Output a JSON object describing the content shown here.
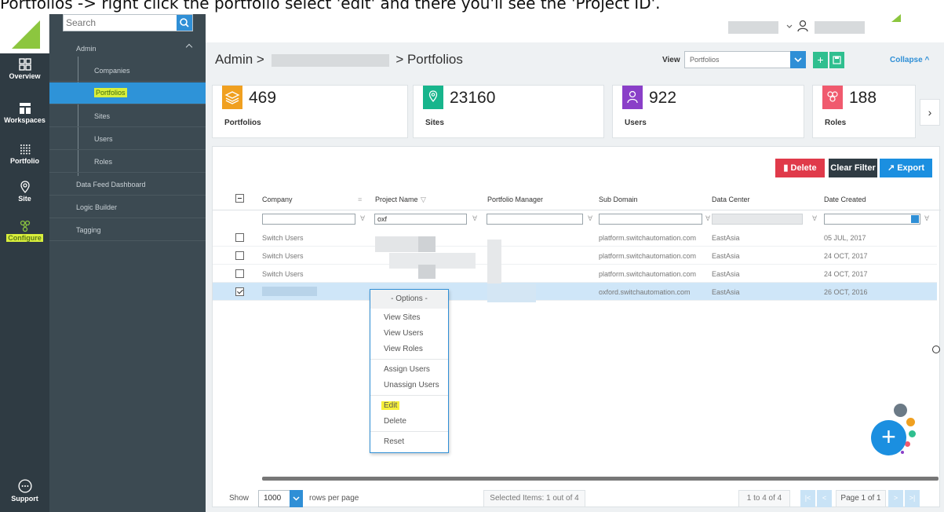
{
  "caption": "Portfolios -> right click the portfolio select 'edit' and there you'll see the 'Project ID'.",
  "colors": {
    "accent": "#2f8fd6",
    "highlight": "#f6f03a",
    "brand_green": "#8cc63f",
    "delete_red": "#e03a4a"
  },
  "rail": {
    "items": [
      {
        "label": "Overview",
        "icon": "grid-icon"
      },
      {
        "label": "Workspaces",
        "icon": "workspace-icon"
      },
      {
        "label": "Portfolio",
        "icon": "dots-grid-icon"
      },
      {
        "label": "Site",
        "icon": "location-pin-icon"
      },
      {
        "label": "Configure",
        "icon": "configure-icon"
      },
      {
        "label": "Support",
        "icon": "chat-bubble-icon"
      }
    ]
  },
  "nav": {
    "search_placeholder": "Search",
    "admin_label": "Admin",
    "items": [
      "Companies",
      "Portfolios",
      "Sites",
      "Users",
      "Roles"
    ],
    "other": [
      "Data Feed Dashboard",
      "Logic Builder",
      "Tagging"
    ]
  },
  "header": {
    "crumb_start": "Admin >",
    "crumb_end": "> Portfolios",
    "view_label": "View",
    "view_value": "Portfolios",
    "collapse": "Collapse ^"
  },
  "stats": [
    {
      "value": "469",
      "label": "Portfolios",
      "color": "#f0a020"
    },
    {
      "value": "23160",
      "label": "Sites",
      "color": "#17b58c"
    },
    {
      "value": "922",
      "label": "Users",
      "color": "#8a3fc8"
    },
    {
      "value": "188",
      "label": "Roles",
      "color": "#f05a6e"
    }
  ],
  "toolbar": {
    "delete": "Delete",
    "clear_filter": "Clear Filter",
    "export": "Export"
  },
  "table": {
    "columns": [
      "Company",
      "Project Name",
      "Portfolio Manager",
      "Sub Domain",
      "Data Center",
      "Date Created"
    ],
    "filter_project": "oxf",
    "rows": [
      {
        "company": "Switch Users",
        "subdomain": "platform.switchautomation.com",
        "datacenter": "EastAsia",
        "date": "05 JUL, 2017",
        "checked": false
      },
      {
        "company": "Switch Users",
        "subdomain": "platform.switchautomation.com",
        "datacenter": "EastAsia",
        "date": "24 OCT, 2017",
        "checked": false
      },
      {
        "company": "Switch Users",
        "subdomain": "platform.switchautomation.com",
        "datacenter": "EastAsia",
        "date": "24 OCT, 2017",
        "checked": false
      },
      {
        "company": "",
        "subdomain": "oxford.switchautomation.com",
        "datacenter": "EastAsia",
        "date": "26 OCT, 2016",
        "checked": true
      }
    ]
  },
  "context_menu": {
    "header": "- Options -",
    "items": [
      "View Sites",
      "View Users",
      "View Roles",
      "Assign Users",
      "Unassign Users",
      "Edit",
      "Delete",
      "Reset"
    ]
  },
  "footer": {
    "show": "Show",
    "rows_value": "1000",
    "rows_per_page": "rows per page",
    "selected": "Selected Items: 1 out of 4",
    "range": "1 to 4 of 4",
    "page": "Page 1 of 1"
  }
}
